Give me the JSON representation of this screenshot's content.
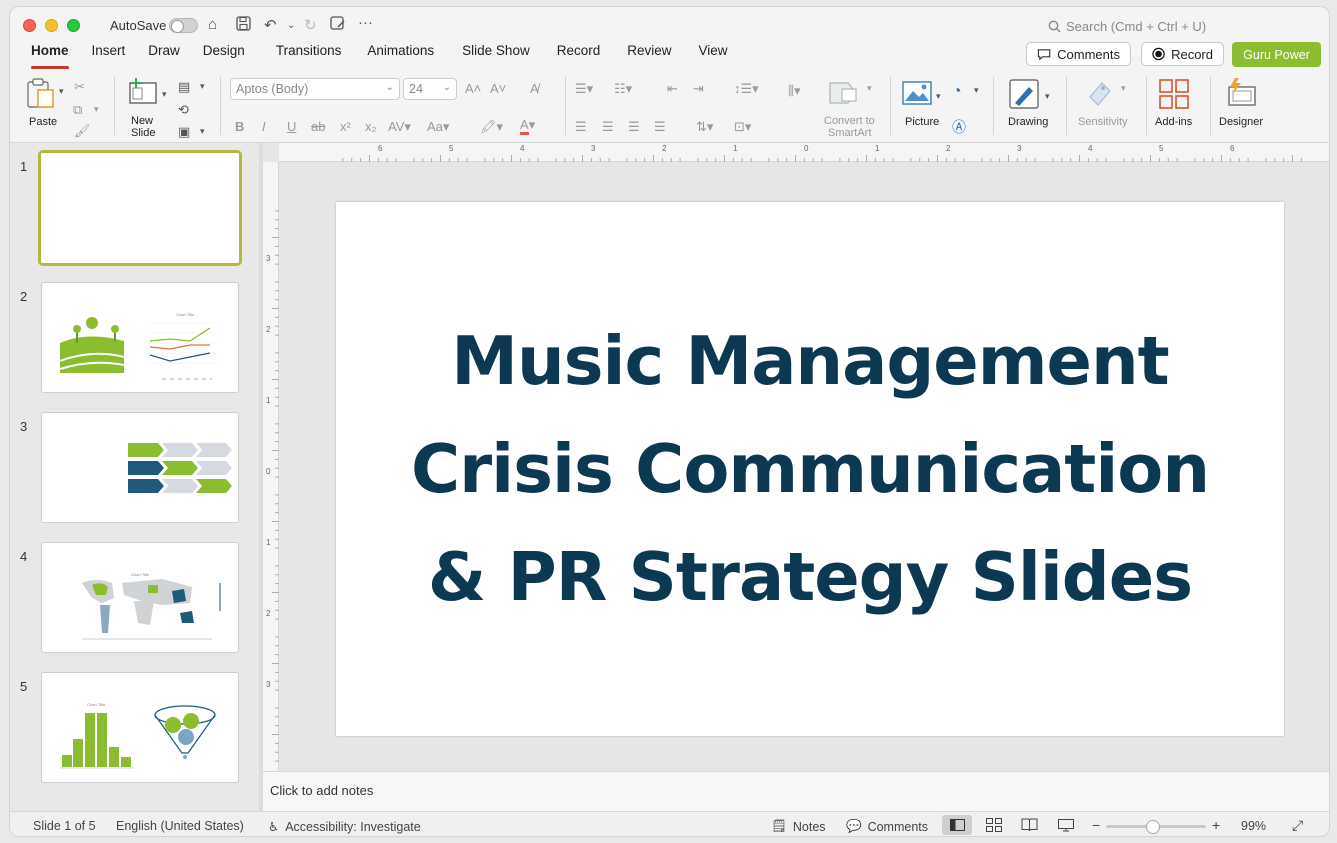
{
  "titlebar": {
    "autosave_label": "AutoSave",
    "search_placeholder": "Search (Cmd + Ctrl + U)"
  },
  "tabs": [
    "Home",
    "Insert",
    "Draw",
    "Design",
    "Transitions",
    "Animations",
    "Slide Show",
    "Record",
    "Review",
    "View"
  ],
  "header_buttons": {
    "comments": "Comments",
    "record": "Record",
    "guru": "Guru Power"
  },
  "ribbon": {
    "paste": "Paste",
    "new_slide_1": "New",
    "new_slide_2": "Slide",
    "font_name": "Aptos (Body)",
    "font_size": "24",
    "convert_1": "Convert to",
    "convert_2": "SmartArt",
    "picture": "Picture",
    "drawing": "Drawing",
    "sensitivity": "Sensitivity",
    "addins": "Add-ins",
    "designer": "Designer"
  },
  "ruler_h_labels": [
    "6",
    "5",
    "4",
    "3",
    "2",
    "1",
    "0",
    "1",
    "2",
    "3",
    "4",
    "5",
    "6"
  ],
  "ruler_v_labels": [
    "3",
    "2",
    "1",
    "0",
    "1",
    "2",
    "3"
  ],
  "thumbnails": [
    {
      "num": "1"
    },
    {
      "num": "2",
      "chart_title": "Chart Title"
    },
    {
      "num": "3"
    },
    {
      "num": "4",
      "chart_title": "Chart Title"
    },
    {
      "num": "5",
      "chart_title": "Chart Title"
    }
  ],
  "slide": {
    "title_line1": "Music Management",
    "title_line2": "Crisis Communication",
    "title_line3": "& PR Strategy Slides"
  },
  "notes_placeholder": "Click to add notes",
  "status": {
    "slide_count": "Slide 1 of 5",
    "language": "English (United States)",
    "accessibility": "Accessibility: Investigate",
    "notes": "Notes",
    "comments": "Comments",
    "zoom": "99%"
  },
  "colors": {
    "title_navy": "#0d3852",
    "accent_green": "#8cbc2f",
    "accent_navy": "#1f5a7a",
    "tab_underline": "#c0392b"
  }
}
